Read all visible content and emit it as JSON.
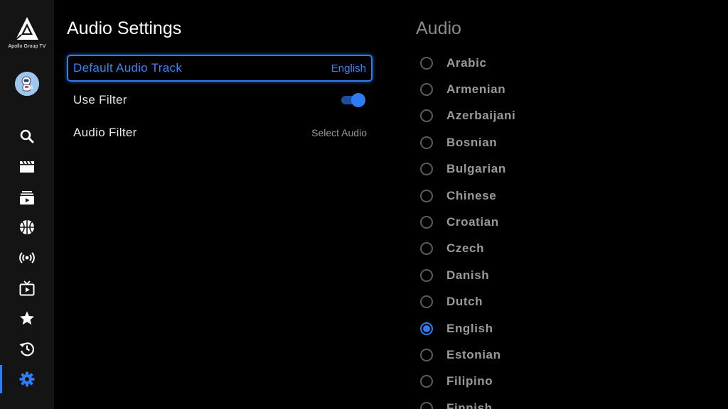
{
  "sidebar": {
    "logo_text": "Apollo Group TV",
    "nav": [
      {
        "icon": "search-icon"
      },
      {
        "icon": "movies-icon"
      },
      {
        "icon": "series-icon"
      },
      {
        "icon": "sports-icon"
      },
      {
        "icon": "live-broadcast-icon"
      },
      {
        "icon": "tv-guide-icon"
      },
      {
        "icon": "favorites-star-icon"
      },
      {
        "icon": "history-icon"
      },
      {
        "icon": "settings-gear-icon",
        "active": true
      }
    ]
  },
  "settings": {
    "title": "Audio Settings",
    "rows": [
      {
        "label": "Default Audio Track",
        "value": "English",
        "focused": true
      },
      {
        "label": "Use Filter",
        "toggle": true
      },
      {
        "label": "Audio Filter",
        "value": "Select Audio"
      }
    ]
  },
  "audio": {
    "title": "Audio",
    "languages": [
      "Arabic",
      "Armenian",
      "Azerbaijani",
      "Bosnian",
      "Bulgarian",
      "Chinese",
      "Croatian",
      "Czech",
      "Danish",
      "Dutch",
      "English",
      "Estonian",
      "Filipino",
      "Finnish"
    ],
    "selected": "English"
  },
  "colors": {
    "accent": "#2e7cf6",
    "sidebar_bg": "#141414",
    "background": "#000000"
  }
}
